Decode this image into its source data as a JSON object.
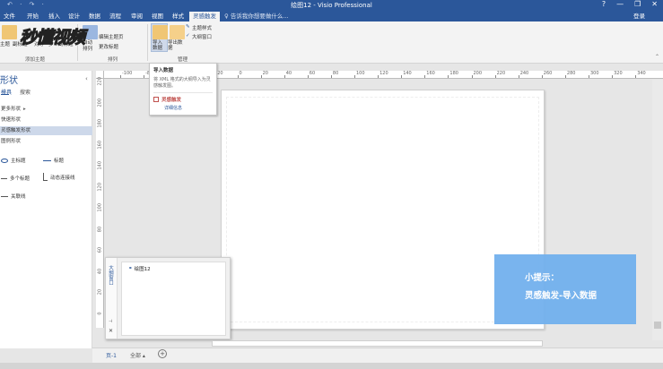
{
  "window": {
    "title": "绘图12 - Visio Professional",
    "quick_access": "↶ · ↷ ·",
    "controls": [
      "?",
      "—",
      "❐",
      "✕"
    ]
  },
  "ribbon_tabs": [
    "文件",
    "开始",
    "插入",
    "设计",
    "数据",
    "流程",
    "审阅",
    "视图",
    "样式",
    "灵感触发"
  ],
  "tell_me": "♀ 告诉我你想要做什么...",
  "login": "登录",
  "ribbon": {
    "topics_group": {
      "label": "添加主题",
      "buttons": [
        "主题",
        "副标题",
        "对等",
        "多个副标题"
      ]
    },
    "arrange_group": {
      "label": "排列",
      "buttons": [
        "自动排列",
        "编辑主题",
        "更改标题"
      ],
      "relayout_label": "编辑主题页"
    },
    "manage_group": {
      "label": "管理",
      "import_button": "导入数据",
      "export_button": "导出数据",
      "theme_style": "主题样式",
      "outline_window": "大纲窗口"
    }
  },
  "import_tooltip": {
    "title": "导入数据",
    "description": "将 XML 格式的大纲导入为灵感触发图。",
    "addin": "灵感触发",
    "more_info": "详细信息"
  },
  "shapes_pane": {
    "title": "形状",
    "tabs": [
      "模具",
      "搜索"
    ],
    "stencils": [
      "更多形状",
      "快速形状",
      "灵感触发形状",
      "图例形状"
    ],
    "masters": [
      "主标题",
      "标题",
      "多个标题",
      "动态连接线",
      "关联线"
    ]
  },
  "ruler": {
    "h_ticks": [
      "-100",
      "-80",
      "-60",
      "-40",
      "-20",
      "0",
      "20",
      "40",
      "60",
      "80",
      "100",
      "120",
      "140",
      "160",
      "180",
      "200",
      "220",
      "240",
      "260",
      "280",
      "300",
      "320",
      "340"
    ],
    "v_ticks": [
      "220",
      "200",
      "180",
      "160",
      "140",
      "120",
      "100",
      "80",
      "60",
      "40",
      "20",
      "0"
    ]
  },
  "nav_window": {
    "title": "大纲窗口",
    "item": "绘图12"
  },
  "hint": {
    "line1": "小提示：",
    "line2": "灵感触发-导入数据"
  },
  "page_tabs": {
    "current": "页-1",
    "all": "全部 ▴",
    "add": "+"
  },
  "watermark": "秒懂视频",
  "colors": {
    "accent": "#2b579a",
    "hint_bg": "#72b1ee"
  }
}
